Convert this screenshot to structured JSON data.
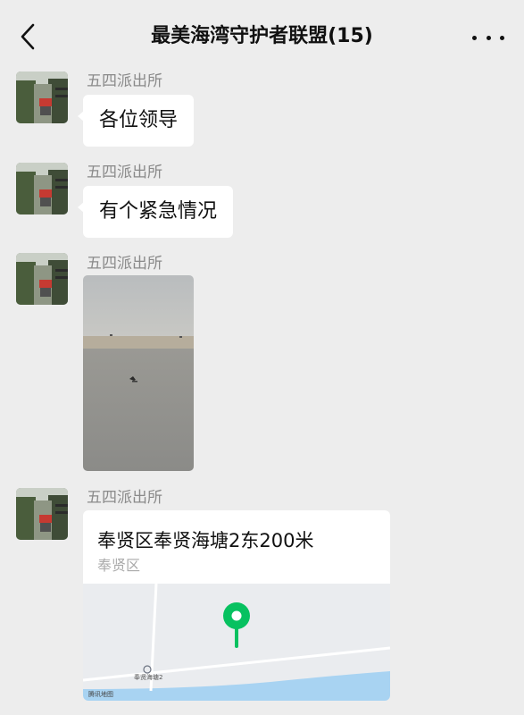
{
  "header": {
    "title": "最美海湾守护者联盟(15)"
  },
  "colors": {
    "background": "#ededed",
    "bubble": "#ffffff",
    "map_pin": "#07c160",
    "sender_name": "#8a8a8a"
  },
  "icons": {
    "back": "chevron-left-icon",
    "more": "more-dots-icon",
    "pin": "map-pin-icon"
  },
  "messages": [
    {
      "sender": "五四派出所",
      "type": "text",
      "text": "各位领导"
    },
    {
      "sender": "五四派出所",
      "type": "text",
      "text": "有个紧急情况"
    },
    {
      "sender": "五四派出所",
      "type": "image"
    },
    {
      "sender": "五四派出所",
      "type": "location",
      "title": "奉贤区奉贤海塘2东200米",
      "subtitle": "奉贤区",
      "map_label": "奉贤海塘2",
      "map_provider": "腾讯地图"
    }
  ]
}
